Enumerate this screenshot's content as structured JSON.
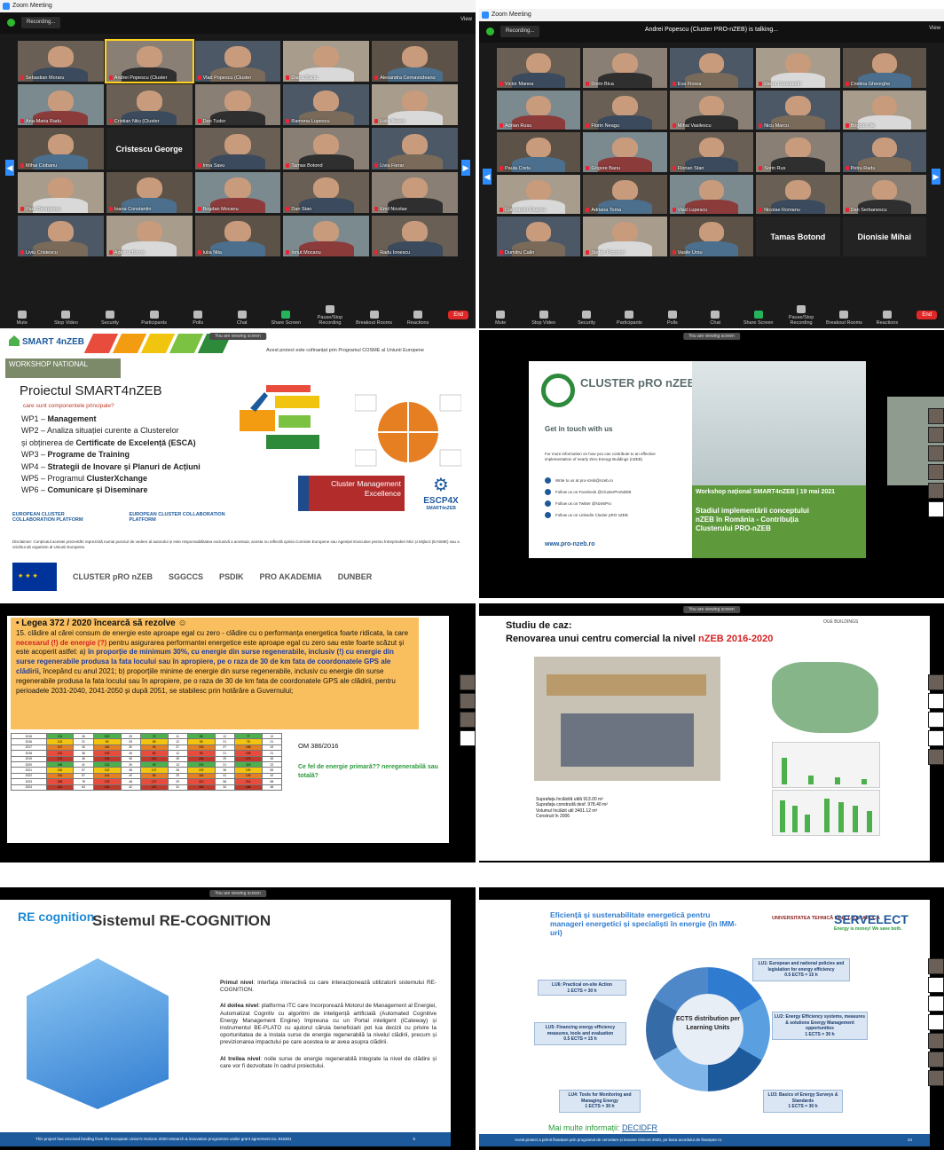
{
  "zoom_left": {
    "title": "Zoom Meeting",
    "rec_label": "Recording...",
    "view_label": "View",
    "tiles": [
      {
        "name": "Sebastian Moraru",
        "kind": "video"
      },
      {
        "name": "Andrei Popescu (Cluster",
        "kind": "video",
        "active": true
      },
      {
        "name": "Vlad Popescu (Cluster",
        "kind": "video"
      },
      {
        "name": "Diana Baciu",
        "kind": "video"
      },
      {
        "name": "Alexandra Cernavodeanu",
        "kind": "video"
      },
      {
        "name": "Ana-Maria Radu",
        "kind": "video"
      },
      {
        "name": "Cristian Nitu (Cluster",
        "kind": "video"
      },
      {
        "name": "Dan Tudor",
        "kind": "video"
      },
      {
        "name": "Ramona Lupescu",
        "kind": "video"
      },
      {
        "name": "Lidia Iliescu",
        "kind": "video"
      },
      {
        "name": "Mihai Ciobanu",
        "kind": "video"
      },
      {
        "name": "Cristescu George",
        "kind": "text"
      },
      {
        "name": "Irina Savu",
        "kind": "video"
      },
      {
        "name": "Tamas Botond",
        "kind": "video"
      },
      {
        "name": "Livia Fierar",
        "kind": "video"
      },
      {
        "name": "Paul Georgescu",
        "kind": "video"
      },
      {
        "name": "Ioana Constantin",
        "kind": "video"
      },
      {
        "name": "Bogdan Mocanu",
        "kind": "video"
      },
      {
        "name": "Dan Stan",
        "kind": "video"
      },
      {
        "name": "Emil Nicolae",
        "kind": "video"
      },
      {
        "name": "Liviu Cristescu",
        "kind": "video"
      },
      {
        "name": "Adelina Boros",
        "kind": "video"
      },
      {
        "name": "Iulia Nita",
        "kind": "video"
      },
      {
        "name": "Ionut Mocanu",
        "kind": "video"
      },
      {
        "name": "Radu Ionescu",
        "kind": "video"
      }
    ],
    "toolbar": [
      "Mute",
      "Stop Video",
      "Security",
      "Participants",
      "Polls",
      "Chat",
      "Share Screen",
      "Pause/Stop Recording",
      "Breakout Rooms",
      "Reactions"
    ],
    "end_label": "End"
  },
  "zoom_right": {
    "title": "Zoom Meeting",
    "rec_label": "Recording...",
    "talking": "Andrei Popescu (Cluster PRO-nZEB) is talking...",
    "view_label": "View",
    "tiles": [
      {
        "name": "Victor Manea",
        "kind": "video"
      },
      {
        "name": "Dorin Bica",
        "kind": "video"
      },
      {
        "name": "Eva Florea",
        "kind": "video"
      },
      {
        "name": "Elena Constantin",
        "kind": "video"
      },
      {
        "name": "Cristina Gheorghe",
        "kind": "video"
      },
      {
        "name": "Adrian Rusu",
        "kind": "video"
      },
      {
        "name": "Florin Neagu",
        "kind": "video"
      },
      {
        "name": "Mihai Vasilescu",
        "kind": "video"
      },
      {
        "name": "Nicu Marcu",
        "kind": "video"
      },
      {
        "name": "Bogdan Ilie",
        "kind": "video"
      },
      {
        "name": "Paula Cretu",
        "kind": "video"
      },
      {
        "name": "Grigore Banu",
        "kind": "video"
      },
      {
        "name": "Florian Stan",
        "kind": "video"
      },
      {
        "name": "Sorin Rus",
        "kind": "video"
      },
      {
        "name": "Petru Radu",
        "kind": "video"
      },
      {
        "name": "Constantin Enache",
        "kind": "video"
      },
      {
        "name": "Adriana Toma",
        "kind": "video"
      },
      {
        "name": "Vlad Lupescu",
        "kind": "video"
      },
      {
        "name": "Nicolae Romanu",
        "kind": "video"
      },
      {
        "name": "Dan Serbanescu",
        "kind": "video"
      },
      {
        "name": "Dumitru Calin",
        "kind": "video"
      },
      {
        "name": "Stefan Popovici",
        "kind": "video"
      },
      {
        "name": "Vasile Ursu",
        "kind": "video"
      },
      {
        "name": "Tamas Botond",
        "kind": "text"
      },
      {
        "name": "Dionisie Mihai",
        "kind": "text"
      }
    ],
    "toolbar": [
      "Mute",
      "Stop Video",
      "Security",
      "Participants",
      "Polls",
      "Chat",
      "Share Screen",
      "Pause/Stop Recording",
      "Breakout Rooms",
      "Reactions"
    ],
    "end_label": "End"
  },
  "slide_smart": {
    "share_label": "You are viewing screen",
    "brand": "SMART 4nZEB",
    "workshop": "WORKSHOP NATIONAL",
    "disclaimer_top": "Acest proiect este cofinanțat prin Programul COSME al Uniunii Europene",
    "title": "Proiectul SMART4nZEB",
    "subtitle": "care sunt componentele principale?",
    "wp": [
      {
        "code": "WP1 – ",
        "text": "Management"
      },
      {
        "code": "WP2 – Analiza situației curente a Clusterelor",
        "text": ""
      },
      {
        "code": "și obținerea de ",
        "text": "Certificate de Excelență (ESCA)"
      },
      {
        "code": "WP3 – ",
        "text": "Programe de Training"
      },
      {
        "code": "WP4 – ",
        "text": "Strategii de Inovare și Planuri de Acțiuni"
      },
      {
        "code": "WP5 – Programul ",
        "text": "ClusterXchange"
      },
      {
        "code": "WP6 – ",
        "text": "Comunicare și Diseminare"
      }
    ],
    "cme": "Cluster Management Excellence",
    "bronze": "BRONZE",
    "escp": "ESCP4X",
    "escp_sub": "SMART4nZEB",
    "ecc1": "EUROPEAN CLUSTER COLLABORATION PLATFORM",
    "ecc2": "EUROPEAN CLUSTER COLLABORATION PLATFORM",
    "disclaimer": "Disclaimer: Conținutul acestei prezentări reprezintă numai punctul de vedere al autorului și este responsabilitatea exclusivă a acestuia; acesta nu reflectă opinia Comisiei Europene sau Agenției Executive pentru Întreprinderi Mici și Mijlocii (EASME) sau a oricărui alt organism al Uniunii Europene.",
    "footer_logos": [
      "CLUSTER pRO nZEB",
      "SGGCCS",
      "PSDIK",
      "PRO AKADEMIA",
      "DUNBER"
    ]
  },
  "slide_cluster": {
    "share_label": "You are viewing screen",
    "logo_text": "CLUSTER pRO nZEB",
    "get_in_touch": "Get in touch with us",
    "small": "For more information on how you can contribute to an effective implementation of nearly Zero Energy Buildings (nZEB)",
    "contacts": [
      "Write to us at pro-nzeb@nzeb.ro",
      "Follow us on Facebook @ClusterProNZEB",
      "Follow us on Twitter @NzebPro",
      "Follow us on Linkedin Cluster pRO nZEB"
    ],
    "url": "www.pro-nzeb.ro",
    "workshop": "Workshop național SMART4nZEB  |  19 mai 2021",
    "stage": "Stadiul implementării conceptului nZEB în România - Contribuția Clusterului PRO-nZEB"
  },
  "slide_legea": {
    "heading": "Legea 372 / 2020 încearcă să rezolve ☺",
    "p1": "15. clădire al cărei consum de energie este aproape egal cu zero - clădire cu o performanța energetica foarte ridicata, la care ",
    "p1_red": "necesarul (!) de energie (?)",
    "p1b": " pentru asigurarea performantei energetice este aproape egal cu zero sau este foarte scăzut și este acoperit astfel: a) ",
    "p1_blue": "în proporție de minimum 30%, cu energie din surse regenerabile, inclusiv (!) cu energie din surse regenerabile produsa la fata locului sau în apropiere, pe o raza de 30 de km fata de coordonatele GPS ale clădirii,",
    "p1c": " începând cu anul 2021; b) proporțiile minime de energie din surse regenerabile, inclusiv cu energie din surse regenerabile produsa la fata locului sau în apropiere, pe o raza de 30 de km fata de coordonatele GPS ale clădirii, pentru perioadele 2031-2040, 2041-2050 și după 2051, se stabilesc prin hotărâre a Guvernului;",
    "om": "OM 386/2016",
    "question": "Ce fel de energie primară?? neregenerabilă sau totală?",
    "table_rows": [
      [
        "2015",
        "131",
        "26",
        "100",
        "25",
        "72",
        "11",
        "65",
        "12",
        "77",
        "12"
      ],
      [
        "2016",
        "115",
        "21",
        "90",
        "25",
        "65",
        "12",
        "55",
        "21",
        "75",
        "21"
      ],
      [
        "2017",
        "147",
        "40",
        "115",
        "30",
        "93",
        "27",
        "130",
        "27",
        "158",
        "43"
      ],
      [
        "2018",
        "131",
        "36",
        "105",
        "26",
        "80",
        "12",
        "90",
        "21",
        "105",
        "21"
      ],
      [
        "2019",
        "172",
        "46",
        "130",
        "36",
        "110",
        "28",
        "154",
        "29",
        "171",
        "45"
      ],
      [
        "2020",
        "155",
        "41",
        "132",
        "30",
        "93",
        "13",
        "102",
        "21",
        "115",
        "22"
      ],
      [
        "2021",
        "226",
        "57",
        "192",
        "38",
        "107",
        "28",
        "192",
        "36",
        "190",
        "55"
      ],
      [
        "2022",
        "231",
        "57",
        "144",
        "40",
        "89",
        "29",
        "118",
        "41",
        "149",
        "42"
      ],
      [
        "2023",
        "248",
        "78",
        "178",
        "48",
        "127",
        "29",
        "210",
        "58",
        "214",
        "58"
      ],
      [
        "2024",
        "221",
        "64",
        "132",
        "42",
        "107",
        "31",
        "150",
        "34",
        "166",
        "48"
      ]
    ]
  },
  "slide_studiu": {
    "share_label": "You are viewing screen",
    "head1": "Studiu de caz:",
    "head2": "Renovarea unui centru comercial la nivel ",
    "head2_red": "nZEB 2016-2020",
    "brand": "OUE BUILDINGS",
    "info": [
      "Suprafața încălzită utilă   913.00 m²",
      "Suprafața construită desf.   978.40 m²",
      "Volumul încălzit util   3401.12 m³",
      "Construit în 2006"
    ]
  },
  "slide_recog": {
    "share_label": "You are viewing screen",
    "logo": "RE cognition",
    "title": "Sistemul RE-COGNITION",
    "p1_head": "Primul nivel",
    "p1": ": interfața interactivă cu care interacționează utilizatorii sistemului RE-COGNITION.",
    "p2_head": "Al doilea nivel",
    "p2": ": platforma ITC care încorporează Motorul de Management al Energiei, Automatizat Cognitiv cu algoritmi de inteligență artificială (Automated Cognitive Energy Management Engine) împreuna cu un Portal inteligent (iCateway) și instrumentul BE-PLATO cu ajutorul căruia beneficiarii pot lua decizii cu privire la oportunitatea de a instala surse de energie regenerabilă la nivelul clădirii, precum și previzionarea impactului pe care acestea le ar avea asupra clădirii.",
    "p3_head": "Al treilea nivel",
    "p3": ": noile surse de energie regenerabilă integrate la nivel de clădire și care vor fi dezvoltate în cadrul proiectului.",
    "footer": "This project has received funding from the European Union's Horizon 2020 research & innovation programme under grant agreement no. 815301",
    "page": "5"
  },
  "slide_serv": {
    "title": "Eficiență și sustenabilitate energetică pentru manageri energetici și specialiști în energie (în IMM-uri)",
    "utc": "UNIVERSITATEA TEHNICĂ DIN CLUJ-NAPOCA",
    "serv": "SERVELECT",
    "serv_sub": "Energy is money! We save both.",
    "center": "ECTS distribution per Learning Units",
    "lu": [
      {
        "title": "LU1: European and national policies and legislation for energy efficiency",
        "ects": "0.5 ECTS = 15 h"
      },
      {
        "title": "LU2: Energy Efficiency systems, measures & solutions Energy Management opportunities",
        "ects": "1 ECTS = 30 h"
      },
      {
        "title": "LU3: Basics of Energy Surveys & Standards",
        "ects": "1 ECTS = 30 h"
      },
      {
        "title": "LU4: Tools for Monitoring and Managing Energy",
        "ects": "1 ECTS = 30 h"
      },
      {
        "title": "LU5: Financing energy efficiency measures, tools and evaluation",
        "ects": "0.5 ECTS = 15 h"
      },
      {
        "title": "LU6: Practical on-site Action",
        "ects": "1 ECTS = 30 h"
      }
    ],
    "more": "Mai multe informații: ",
    "link": "DECIDFR",
    "footer": "Acest proiect a primit finanțare prin programul de cercetare și inovare Orizont 2020, pe baza acordului de finanțare nr.",
    "page": "24"
  }
}
